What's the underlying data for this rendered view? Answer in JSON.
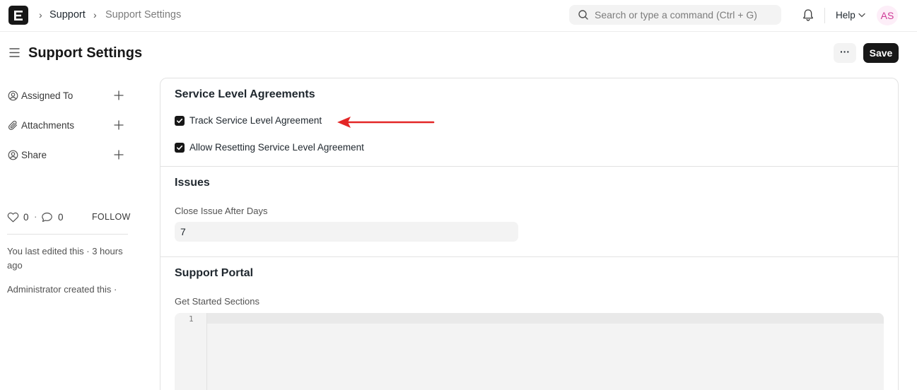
{
  "navbar": {
    "breadcrumbs": [
      "Support",
      "Support Settings"
    ],
    "search_placeholder": "Search or type a command (Ctrl + G)",
    "help_label": "Help",
    "avatar_initials": "AS"
  },
  "page": {
    "title": "Support Settings",
    "more_label": "···",
    "save_label": "Save"
  },
  "sidebar": {
    "items": [
      {
        "label": "Assigned To",
        "icon": "user-circle-icon"
      },
      {
        "label": "Attachments",
        "icon": "paperclip-icon"
      },
      {
        "label": "Share",
        "icon": "share-user-icon"
      }
    ],
    "likes_count": "0",
    "comments_count": "0",
    "separator": "·",
    "follow_label": "FOLLOW",
    "last_edited": "You last edited this · 3 hours ago",
    "created": "Administrator created this ·"
  },
  "form": {
    "sla": {
      "title": "Service Level Agreements",
      "track_label": "Track Service Level Agreement",
      "track_checked": true,
      "reset_label": "Allow Resetting Service Level Agreement",
      "reset_checked": true
    },
    "issues": {
      "title": "Issues",
      "close_label": "Close Issue After Days",
      "close_value": "7"
    },
    "portal": {
      "title": "Support Portal",
      "sections_label": "Get Started Sections",
      "line_number": "1"
    }
  },
  "colors": {
    "accent_dark": "#171717",
    "annotation_arrow": "#e32626",
    "avatar_bg": "#fdeef8",
    "avatar_text": "#cf3a96"
  }
}
